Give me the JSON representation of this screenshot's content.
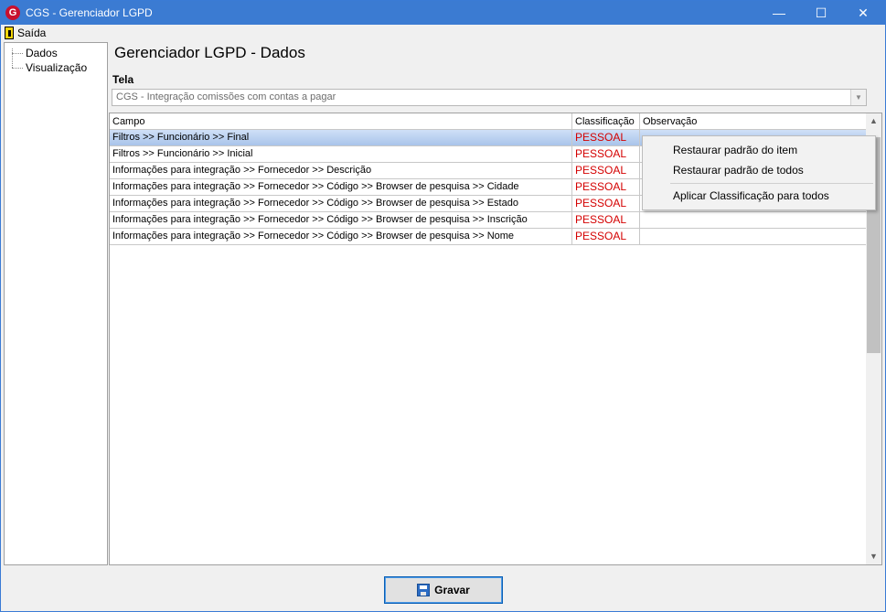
{
  "window": {
    "title": "CGS - Gerenciador LGPD",
    "minimize": "—",
    "maximize": "☐",
    "close": "✕"
  },
  "menu": {
    "exit_label": "Saída"
  },
  "tree": {
    "items": [
      "Dados",
      "Visualização"
    ]
  },
  "page": {
    "heading": "Gerenciador LGPD - Dados",
    "tela_label": "Tela"
  },
  "combo": {
    "value": "CGS - Integração comissões com contas a pagar",
    "arrow": "▼"
  },
  "grid": {
    "columns": [
      "Campo",
      "Classificação",
      "Observação"
    ],
    "rows": [
      {
        "campo": "Filtros >> Funcionário >> Final",
        "classificacao": "PESSOAL",
        "observacao": ""
      },
      {
        "campo": "Filtros >> Funcionário >> Inicial",
        "classificacao": "PESSOAL",
        "observacao": ""
      },
      {
        "campo": "Informações para integração >> Fornecedor  >> Descrição",
        "classificacao": "PESSOAL",
        "observacao": ""
      },
      {
        "campo": "Informações para integração >> Fornecedor >> Código >> Browser de pesquisa >> Cidade",
        "classificacao": "PESSOAL",
        "observacao": ""
      },
      {
        "campo": "Informações para integração >> Fornecedor >> Código >> Browser de pesquisa >> Estado",
        "classificacao": "PESSOAL",
        "observacao": ""
      },
      {
        "campo": "Informações para integração >> Fornecedor >> Código >> Browser de pesquisa >> Inscrição",
        "classificacao": "PESSOAL",
        "observacao": ""
      },
      {
        "campo": "Informações para integração >> Fornecedor >> Código >> Browser de pesquisa >> Nome",
        "classificacao": "PESSOAL",
        "observacao": ""
      }
    ],
    "selected_row": 0,
    "scroll_up": "▲",
    "scroll_down": "▼"
  },
  "context_menu": {
    "items": [
      "Restaurar padrão do item",
      "Restaurar padrão de todos",
      "Aplicar Classificação para todos"
    ]
  },
  "footer": {
    "save_label": "Gravar"
  },
  "colors": {
    "titlebar": "#3b7bd2",
    "classification": "#d40000",
    "selection": "#a9c4ea"
  }
}
